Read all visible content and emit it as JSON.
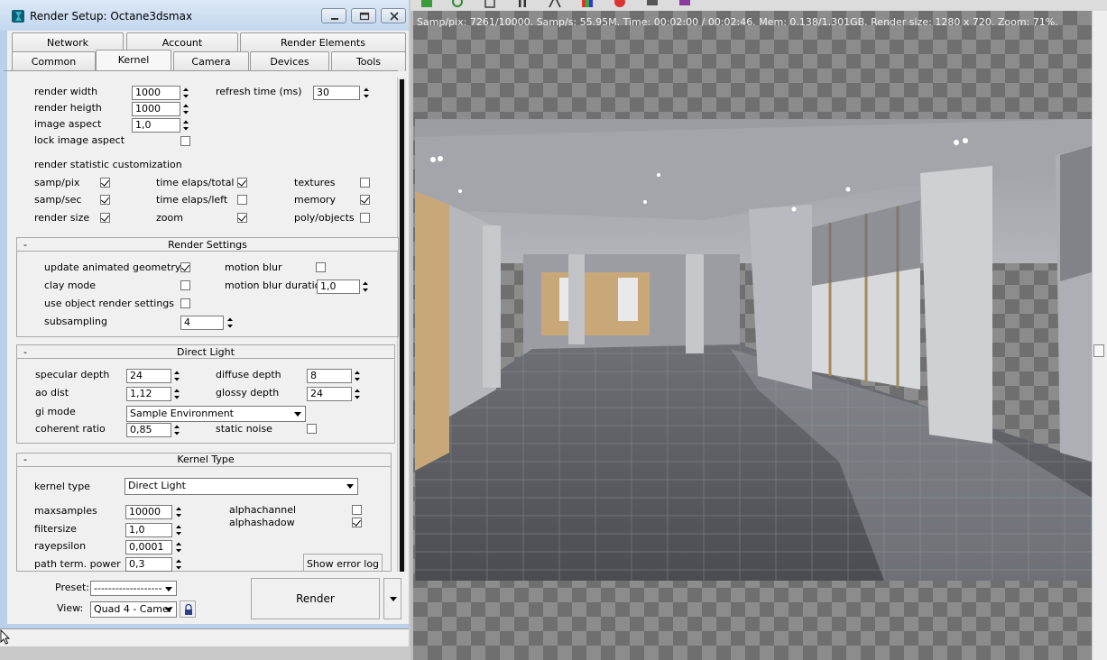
{
  "window": {
    "title": "Render Setup: Octane3dsmax"
  },
  "tabs_row1": [
    "Network",
    "Account",
    "Render Elements"
  ],
  "tabs_row2": [
    "Common",
    "Kernel",
    "Camera",
    "Devices",
    "Tools"
  ],
  "active_tab": "Kernel",
  "image_settings": {
    "render_width_label": "render width",
    "render_width": "1000",
    "render_height_label": "render heigth",
    "render_height": "1000",
    "image_aspect_label": "image aspect",
    "image_aspect": "1,0",
    "lock_aspect_label": "lock image aspect",
    "refresh_label": "refresh time (ms)",
    "refresh_value": "30"
  },
  "statistics": {
    "heading": "render statistic customization",
    "items": [
      {
        "label": "samp/pix",
        "checked": true
      },
      {
        "label": "time elaps/total",
        "checked": true
      },
      {
        "label": "textures",
        "checked": false
      },
      {
        "label": "samp/sec",
        "checked": true
      },
      {
        "label": "time elaps/left",
        "checked": false
      },
      {
        "label": "memory",
        "checked": true
      },
      {
        "label": "render size",
        "checked": true
      },
      {
        "label": "zoom",
        "checked": true
      },
      {
        "label": "poly/objects",
        "checked": false
      }
    ]
  },
  "render_settings": {
    "title": "Render Settings",
    "update_geometry_label": "update animated geometry",
    "update_geometry": true,
    "motion_blur_label": "motion blur",
    "motion_blur": false,
    "clay_mode_label": "clay mode",
    "clay_mode": false,
    "mb_duration_label": "motion blur duration",
    "mb_duration": "1,0",
    "use_object_label": "use object render settings",
    "use_object": false,
    "subsampling_label": "subsampling",
    "subsampling": "4"
  },
  "direct_light": {
    "title": "Direct Light",
    "specular_depth_label": "specular depth",
    "specular_depth": "24",
    "diffuse_depth_label": "diffuse depth",
    "diffuse_depth": "8",
    "ao_dist_label": "ao dist",
    "ao_dist": "1,12",
    "glossy_depth_label": "glossy depth",
    "glossy_depth": "24",
    "gi_mode_label": "gi mode",
    "gi_mode": "Sample Environment",
    "coherent_ratio_label": "coherent ratio",
    "coherent_ratio": "0,85",
    "static_noise_label": "static noise",
    "static_noise": false
  },
  "kernel_type": {
    "title": "Kernel Type",
    "kernel_type_label": "kernel type",
    "kernel_type": "Direct Light",
    "maxsamples_label": "maxsamples",
    "maxsamples": "10000",
    "filtersize_label": "filtersize",
    "filtersize": "1,0",
    "rayepsilon_label": "rayepsilon",
    "rayepsilon": "0,0001",
    "path_term_label": "path term. power",
    "path_term": "0,3",
    "alphachannel_label": "alphachannel",
    "alphachannel": false,
    "alphashadow_label": "alphashadow",
    "alphashadow": true,
    "error_log_label": "Show error log"
  },
  "footer": {
    "preset_label": "Preset:",
    "preset_value": "-------------------",
    "view_label": "View:",
    "view_value": "Quad 4 - Camer",
    "render_label": "Render"
  },
  "framebuffer": {
    "stats": "Samp/pix: 7261/10000.   Samp/s: 55.95M.   Time: 00:02:00 / 00:02:46.   Mem: 0.138/1.301GB.   Render size: 1280 x 720.   Zoom: 71%."
  },
  "colors": {
    "title_bar": "#c4d7ee",
    "panel_bg": "#f0f0f0",
    "accent_wall": "#c8a878"
  }
}
